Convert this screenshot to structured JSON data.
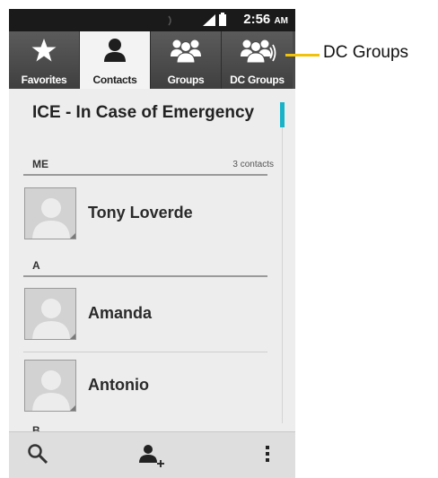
{
  "status_bar": {
    "time": "2:56",
    "ampm": "AM"
  },
  "tabs": [
    {
      "label": "Favorites",
      "icon": "star-icon",
      "active": false
    },
    {
      "label": "Contacts",
      "icon": "person-icon",
      "active": true
    },
    {
      "label": "Groups",
      "icon": "group-icon",
      "active": false
    },
    {
      "label": "DC Groups",
      "icon": "dc-group-icon",
      "active": false
    }
  ],
  "list": {
    "title": "ICE - In Case of Emergency",
    "sections": [
      {
        "label": "ME",
        "count": "3 contacts",
        "contacts": [
          "Tony Loverde"
        ]
      },
      {
        "label": "A",
        "contacts": [
          "Amanda",
          "Antonio"
        ]
      },
      {
        "label": "B"
      }
    ]
  },
  "bottom_bar": {
    "icons": [
      "search-icon",
      "add-contact-icon",
      "overflow-menu-icon"
    ]
  },
  "callout": {
    "text": "DC Groups",
    "color": "#f1c20a"
  },
  "colors": {
    "accent": "#19b3c8",
    "tab_bg": "#4a4a4a",
    "status_bar": "#1a1a1a"
  }
}
